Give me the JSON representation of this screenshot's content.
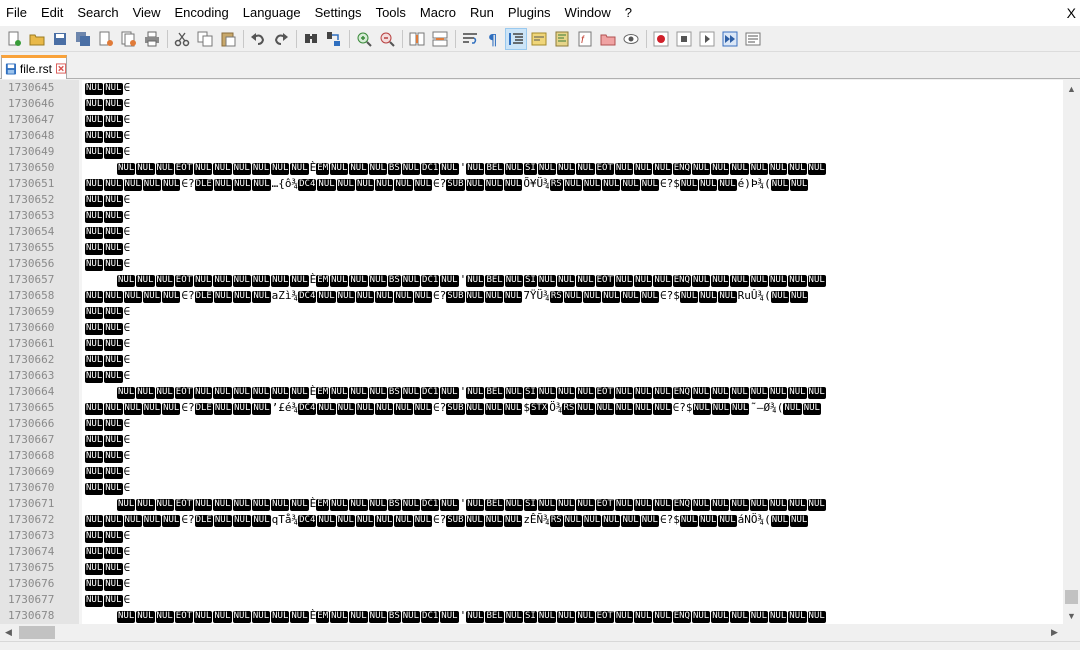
{
  "menu": [
    "File",
    "Edit",
    "Search",
    "View",
    "Encoding",
    "Language",
    "Settings",
    "Tools",
    "Macro",
    "Run",
    "Plugins",
    "Window",
    "?"
  ],
  "close_label": "X",
  "toolbar": [
    {
      "name": "new-file-icon",
      "group": 0
    },
    {
      "name": "open-file-icon",
      "group": 0
    },
    {
      "name": "save-icon",
      "group": 0
    },
    {
      "name": "save-all-icon",
      "group": 0
    },
    {
      "name": "close-file-icon",
      "group": 0
    },
    {
      "name": "close-all-icon",
      "group": 0
    },
    {
      "name": "print-icon",
      "group": 0
    },
    {
      "name": "cut-icon",
      "group": 1
    },
    {
      "name": "copy-icon",
      "group": 1
    },
    {
      "name": "paste-icon",
      "group": 1
    },
    {
      "name": "undo-icon",
      "group": 2
    },
    {
      "name": "redo-icon",
      "group": 2
    },
    {
      "name": "find-icon",
      "group": 3
    },
    {
      "name": "replace-icon",
      "group": 3
    },
    {
      "name": "zoom-in-icon",
      "group": 4
    },
    {
      "name": "zoom-out-icon",
      "group": 4
    },
    {
      "name": "sync-vertical-icon",
      "group": 5
    },
    {
      "name": "sync-horizontal-icon",
      "group": 5
    },
    {
      "name": "word-wrap-icon",
      "group": 6
    },
    {
      "name": "show-all-characters-icon",
      "group": 6
    },
    {
      "name": "indent-guide-icon",
      "group": 6,
      "active": true
    },
    {
      "name": "user-language-icon",
      "group": 6
    },
    {
      "name": "document-map-icon",
      "group": 6
    },
    {
      "name": "function-list-icon",
      "group": 6
    },
    {
      "name": "folder-workspace-icon",
      "group": 6
    },
    {
      "name": "monitoring-icon",
      "group": 6
    },
    {
      "name": "record-macro-icon",
      "group": 7
    },
    {
      "name": "stop-record-icon",
      "group": 7
    },
    {
      "name": "play-macro-icon",
      "group": 7
    },
    {
      "name": "run-macro-multiple-icon",
      "group": 7
    },
    {
      "name": "save-macro-icon",
      "group": 7
    }
  ],
  "tab": {
    "label": "file.rst"
  },
  "segments": {
    "A": [
      [
        "c",
        "NUL"
      ],
      [
        "c",
        "NUL"
      ],
      [
        "t",
        "∈"
      ]
    ],
    "B": [
      [
        "c",
        "NUL"
      ],
      [
        "c",
        "NUL"
      ],
      [
        "c",
        "NUL"
      ],
      [
        "c",
        "EOT"
      ],
      [
        "c",
        "NUL"
      ],
      [
        "c",
        "NUL"
      ],
      [
        "c",
        "NUL"
      ],
      [
        "c",
        "NUL"
      ],
      [
        "c",
        "NUL"
      ],
      [
        "c",
        "NUL"
      ],
      [
        "t",
        "È"
      ],
      [
        "c",
        "EM"
      ],
      [
        "c",
        "NUL"
      ],
      [
        "c",
        "NUL"
      ],
      [
        "c",
        "NUL"
      ],
      [
        "c",
        "BS"
      ],
      [
        "c",
        "NUL"
      ],
      [
        "c",
        "DC1"
      ],
      [
        "c",
        "NUL"
      ],
      [
        "t",
        "'"
      ],
      [
        "c",
        "NUL"
      ],
      [
        "c",
        "BEL"
      ],
      [
        "c",
        "NUL"
      ],
      [
        "c",
        "SI"
      ],
      [
        "c",
        "NUL"
      ],
      [
        "c",
        "NUL"
      ],
      [
        "c",
        "NUL"
      ],
      [
        "c",
        "EOT"
      ],
      [
        "c",
        "NUL"
      ],
      [
        "c",
        "NUL"
      ],
      [
        "c",
        "NUL"
      ],
      [
        "c",
        "ENQ"
      ],
      [
        "c",
        "NUL"
      ],
      [
        "c",
        "NUL"
      ],
      [
        "c",
        "NUL"
      ],
      [
        "c",
        "NUL"
      ],
      [
        "c",
        "NUL"
      ],
      [
        "c",
        "NUL"
      ],
      [
        "c",
        "NUL"
      ]
    ],
    "C1": [
      [
        "c",
        "NUL"
      ],
      [
        "c",
        "NUL"
      ],
      [
        "c",
        "NUL"
      ],
      [
        "c",
        "NUL"
      ],
      [
        "c",
        "NUL"
      ],
      [
        "t",
        "∈?"
      ],
      [
        "c",
        "DLE"
      ],
      [
        "c",
        "NUL"
      ],
      [
        "c",
        "NUL"
      ],
      [
        "c",
        "NUL"
      ],
      [
        "t",
        "…{ô¾"
      ],
      [
        "c",
        "DC4"
      ],
      [
        "c",
        "NUL"
      ],
      [
        "c",
        "NUL"
      ],
      [
        "c",
        "NUL"
      ],
      [
        "c",
        "NUL"
      ],
      [
        "c",
        "NUL"
      ],
      [
        "c",
        "NUL"
      ],
      [
        "t",
        "∈?"
      ],
      [
        "c",
        "SUB"
      ],
      [
        "c",
        "NUL"
      ],
      [
        "c",
        "NUL"
      ],
      [
        "c",
        "NUL"
      ],
      [
        "t",
        "Õ¥Ü¾"
      ],
      [
        "c",
        "RS"
      ],
      [
        "c",
        "NUL"
      ],
      [
        "c",
        "NUL"
      ],
      [
        "c",
        "NUL"
      ],
      [
        "c",
        "NUL"
      ],
      [
        "c",
        "NUL"
      ],
      [
        "t",
        "∈?$"
      ],
      [
        "c",
        "NUL"
      ],
      [
        "c",
        "NUL"
      ],
      [
        "c",
        "NUL"
      ],
      [
        "t",
        "é)Þ¾("
      ],
      [
        "c",
        "NUL"
      ],
      [
        "c",
        "NUL"
      ]
    ],
    "C2": [
      [
        "c",
        "NUL"
      ],
      [
        "c",
        "NUL"
      ],
      [
        "c",
        "NUL"
      ],
      [
        "c",
        "NUL"
      ],
      [
        "c",
        "NUL"
      ],
      [
        "t",
        "∈?"
      ],
      [
        "c",
        "DLE"
      ],
      [
        "c",
        "NUL"
      ],
      [
        "c",
        "NUL"
      ],
      [
        "c",
        "NUL"
      ],
      [
        "t",
        "aZì¾"
      ],
      [
        "c",
        "DC4"
      ],
      [
        "c",
        "NUL"
      ],
      [
        "c",
        "NUL"
      ],
      [
        "c",
        "NUL"
      ],
      [
        "c",
        "NUL"
      ],
      [
        "c",
        "NUL"
      ],
      [
        "c",
        "NUL"
      ],
      [
        "t",
        "∈?"
      ],
      [
        "c",
        "SUB"
      ],
      [
        "c",
        "NUL"
      ],
      [
        "c",
        "NUL"
      ],
      [
        "c",
        "NUL"
      ],
      [
        "t",
        "7ŸÜ¾"
      ],
      [
        "c",
        "RS"
      ],
      [
        "c",
        "NUL"
      ],
      [
        "c",
        "NUL"
      ],
      [
        "c",
        "NUL"
      ],
      [
        "c",
        "NUL"
      ],
      [
        "c",
        "NUL"
      ],
      [
        "t",
        "∈?$"
      ],
      [
        "c",
        "NUL"
      ],
      [
        "c",
        "NUL"
      ],
      [
        "c",
        "NUL"
      ],
      [
        "t",
        "RuÛ¾("
      ],
      [
        "c",
        "NUL"
      ],
      [
        "c",
        "NUL"
      ]
    ],
    "C3": [
      [
        "c",
        "NUL"
      ],
      [
        "c",
        "NUL"
      ],
      [
        "c",
        "NUL"
      ],
      [
        "c",
        "NUL"
      ],
      [
        "c",
        "NUL"
      ],
      [
        "t",
        "∈?"
      ],
      [
        "c",
        "DLE"
      ],
      [
        "c",
        "NUL"
      ],
      [
        "c",
        "NUL"
      ],
      [
        "c",
        "NUL"
      ],
      [
        "t",
        "’£é¾"
      ],
      [
        "c",
        "DC4"
      ],
      [
        "c",
        "NUL"
      ],
      [
        "c",
        "NUL"
      ],
      [
        "c",
        "NUL"
      ],
      [
        "c",
        "NUL"
      ],
      [
        "c",
        "NUL"
      ],
      [
        "c",
        "NUL"
      ],
      [
        "t",
        "∈?"
      ],
      [
        "c",
        "SUB"
      ],
      [
        "c",
        "NUL"
      ],
      [
        "c",
        "NUL"
      ],
      [
        "c",
        "NUL"
      ],
      [
        "t",
        "$"
      ],
      [
        "c",
        "STX"
      ],
      [
        "t",
        "Ö¾"
      ],
      [
        "c",
        "RS"
      ],
      [
        "c",
        "NUL"
      ],
      [
        "c",
        "NUL"
      ],
      [
        "c",
        "NUL"
      ],
      [
        "c",
        "NUL"
      ],
      [
        "c",
        "NUL"
      ],
      [
        "t",
        "∈?$"
      ],
      [
        "c",
        "NUL"
      ],
      [
        "c",
        "NUL"
      ],
      [
        "c",
        "NUL"
      ],
      [
        "t",
        "˜–Ø¾("
      ],
      [
        "c",
        "NUL"
      ],
      [
        "c",
        "NUL"
      ]
    ],
    "C4": [
      [
        "c",
        "NUL"
      ],
      [
        "c",
        "NUL"
      ],
      [
        "c",
        "NUL"
      ],
      [
        "c",
        "NUL"
      ],
      [
        "c",
        "NUL"
      ],
      [
        "t",
        "∈?"
      ],
      [
        "c",
        "DLE"
      ],
      [
        "c",
        "NUL"
      ],
      [
        "c",
        "NUL"
      ],
      [
        "c",
        "NUL"
      ],
      [
        "t",
        "qTå¾"
      ],
      [
        "c",
        "DC4"
      ],
      [
        "c",
        "NUL"
      ],
      [
        "c",
        "NUL"
      ],
      [
        "c",
        "NUL"
      ],
      [
        "c",
        "NUL"
      ],
      [
        "c",
        "NUL"
      ],
      [
        "c",
        "NUL"
      ],
      [
        "t",
        "∈?"
      ],
      [
        "c",
        "SUB"
      ],
      [
        "c",
        "NUL"
      ],
      [
        "c",
        "NUL"
      ],
      [
        "c",
        "NUL"
      ],
      [
        "t",
        "zÊÑ¾"
      ],
      [
        "c",
        "RS"
      ],
      [
        "c",
        "NUL"
      ],
      [
        "c",
        "NUL"
      ],
      [
        "c",
        "NUL"
      ],
      [
        "c",
        "NUL"
      ],
      [
        "c",
        "NUL"
      ],
      [
        "t",
        "∈?$"
      ],
      [
        "c",
        "NUL"
      ],
      [
        "c",
        "NUL"
      ],
      [
        "c",
        "NUL"
      ],
      [
        "t",
        "áNÖ¾("
      ],
      [
        "c",
        "NUL"
      ],
      [
        "c",
        "NUL"
      ]
    ]
  },
  "lines": [
    {
      "n": "1730645",
      "s": "A"
    },
    {
      "n": "1730646",
      "s": "A"
    },
    {
      "n": "1730647",
      "s": "A"
    },
    {
      "n": "1730648",
      "s": "A"
    },
    {
      "n": "1730649",
      "s": "A"
    },
    {
      "n": "1730650",
      "s": "B",
      "indent": true
    },
    {
      "n": "1730651",
      "s": "C1"
    },
    {
      "n": "1730652",
      "s": "A"
    },
    {
      "n": "1730653",
      "s": "A"
    },
    {
      "n": "1730654",
      "s": "A"
    },
    {
      "n": "1730655",
      "s": "A"
    },
    {
      "n": "1730656",
      "s": "A"
    },
    {
      "n": "1730657",
      "s": "B",
      "indent": true
    },
    {
      "n": "1730658",
      "s": "C2"
    },
    {
      "n": "1730659",
      "s": "A"
    },
    {
      "n": "1730660",
      "s": "A"
    },
    {
      "n": "1730661",
      "s": "A"
    },
    {
      "n": "1730662",
      "s": "A"
    },
    {
      "n": "1730663",
      "s": "A"
    },
    {
      "n": "1730664",
      "s": "B",
      "indent": true
    },
    {
      "n": "1730665",
      "s": "C3"
    },
    {
      "n": "1730666",
      "s": "A"
    },
    {
      "n": "1730667",
      "s": "A"
    },
    {
      "n": "1730668",
      "s": "A"
    },
    {
      "n": "1730669",
      "s": "A"
    },
    {
      "n": "1730670",
      "s": "A"
    },
    {
      "n": "1730671",
      "s": "B",
      "indent": true
    },
    {
      "n": "1730672",
      "s": "C4"
    },
    {
      "n": "1730673",
      "s": "A"
    },
    {
      "n": "1730674",
      "s": "A"
    },
    {
      "n": "1730675",
      "s": "A"
    },
    {
      "n": "1730676",
      "s": "A"
    },
    {
      "n": "1730677",
      "s": "A"
    },
    {
      "n": "1730678",
      "s": "B",
      "indent": true
    }
  ],
  "colors": {
    "tab_accent": "#f9a23a",
    "control_char_bg": "#000000",
    "gutter_bg": "#e4e4e4",
    "line_number": "#8a8a8a"
  }
}
